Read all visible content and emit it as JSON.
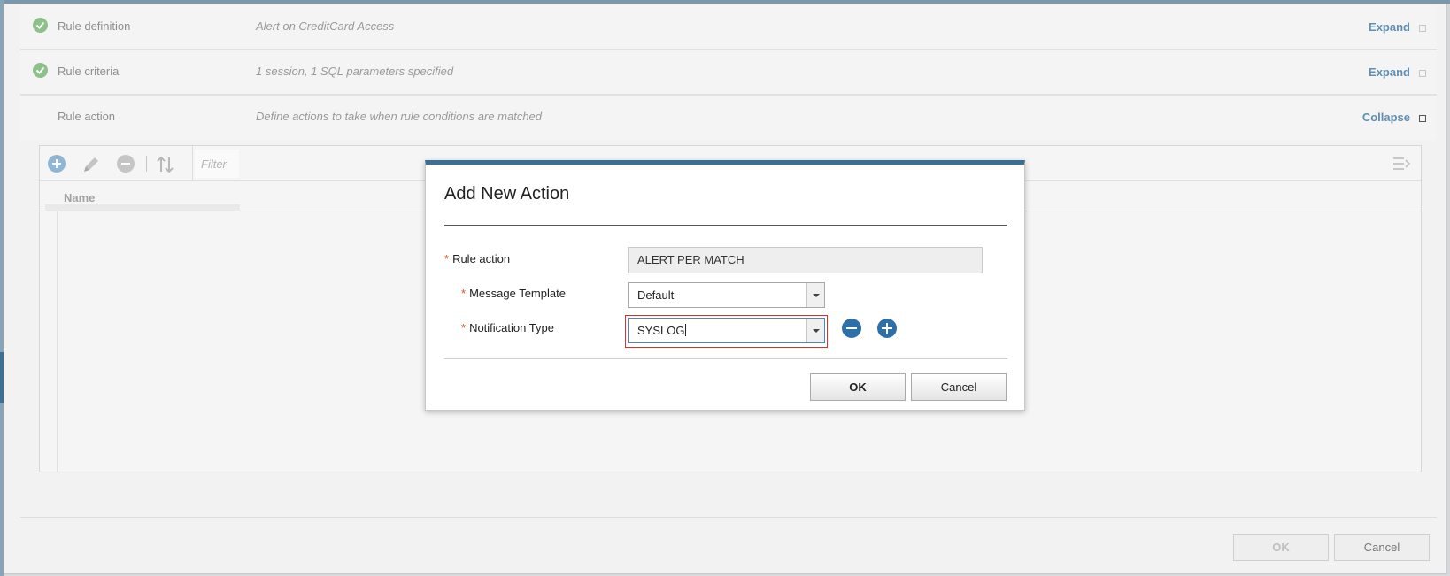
{
  "sections": [
    {
      "title": "Rule definition",
      "description": "Alert on CreditCard Access",
      "toggle": "Expand",
      "completed": true
    },
    {
      "title": "Rule criteria",
      "description": "1 session, 1 SQL parameters specified",
      "toggle": "Expand",
      "completed": true
    },
    {
      "title": "Rule action",
      "description": "Define actions to take when rule conditions are matched",
      "toggle": "Collapse",
      "completed": false
    }
  ],
  "actions_table": {
    "filter_placeholder": "Filter",
    "columns": [
      "Name"
    ]
  },
  "footer": {
    "ok_label": "OK",
    "cancel_label": "Cancel"
  },
  "dialog": {
    "title": "Add New Action",
    "fields": {
      "rule_action": {
        "label": "Rule action",
        "value": "ALERT PER MATCH"
      },
      "message_template": {
        "label": "Message Template",
        "value": "Default"
      },
      "notification_type": {
        "label": "Notification Type",
        "value": "SYSLOG"
      }
    },
    "ok_label": "OK",
    "cancel_label": "Cancel"
  },
  "colors": {
    "accent": "#3a6f98",
    "required_star": "#d9531e",
    "focus_ring": "#e0301e",
    "check_green": "#8dc08b"
  }
}
